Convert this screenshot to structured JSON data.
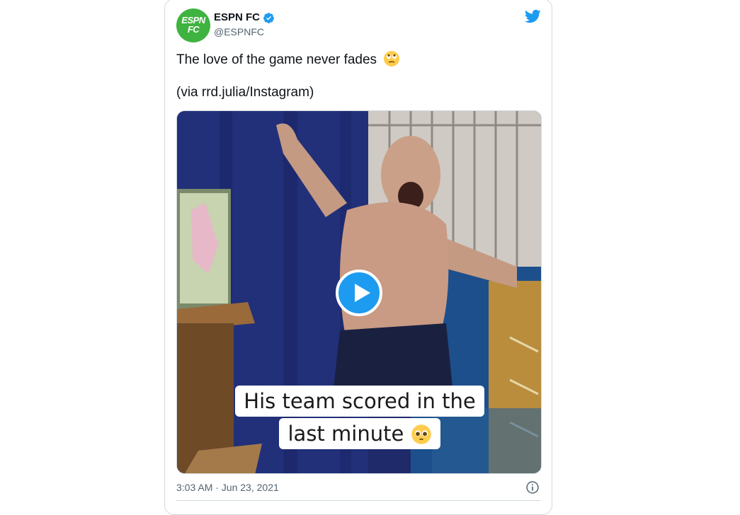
{
  "account": {
    "display_name": "ESPN FC",
    "handle": "@ESPNFC",
    "avatar_text_line1": "ESPN",
    "avatar_text_line2": "FC",
    "verified": true,
    "brand_color": "#3fb33f"
  },
  "tweet": {
    "text_line1": "The love of the game never fades",
    "text_line2": "(via rrd.julia/Instagram)",
    "timestamp": "3:03 AM · Jun 23, 2021"
  },
  "media": {
    "type": "video",
    "caption_line1": "His team scored in the",
    "caption_line2": "last minute"
  },
  "icons": {
    "brand": "twitter-bird-icon",
    "verified": "verified-badge-icon",
    "emoji": "rolling-eyes-emoji-icon",
    "caption_emoji": "pleading-face-emoji-icon",
    "play": "play-icon",
    "info": "info-icon"
  },
  "colors": {
    "accent": "#1d9bf0",
    "secondary_text": "#536471"
  }
}
